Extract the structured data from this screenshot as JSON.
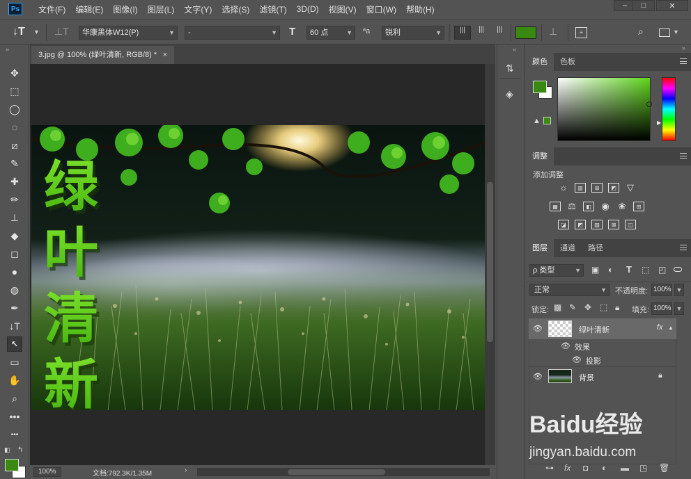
{
  "app": {
    "logo": "Ps",
    "menu": [
      "文件(F)",
      "编辑(E)",
      "图像(I)",
      "图层(L)",
      "文字(Y)",
      "选择(S)",
      "滤镜(T)",
      "3D(D)",
      "视图(V)",
      "窗口(W)",
      "帮助(H)"
    ],
    "window_controls": [
      "–",
      "□",
      "✕"
    ]
  },
  "options": {
    "tool_glyph": "↓T",
    "font_family": "华康黑体W12(P)",
    "font_style": "-",
    "font_size": "60 点",
    "aa_label": "ªa",
    "antialias": "锐利",
    "text_color": "#3a8a12"
  },
  "document": {
    "tab_title": "3.jpg @ 100% (绿叶清新, RGB/8) *",
    "tab_close": "×",
    "overlay_text": [
      "绿",
      "叶",
      "清",
      "新"
    ],
    "zoom": "100%",
    "doc_info": "文档:792.3K/1.35M"
  },
  "tools": [
    "✥",
    "⬚",
    "◯",
    "◌",
    "⧄",
    "✎",
    "✚",
    "✏",
    "⊥",
    "◆",
    "◻",
    "●",
    "◍",
    "✒",
    "↓T",
    "↖",
    "▭",
    "✋",
    "⌕",
    "•••"
  ],
  "colors": {
    "foreground": "#3a8a12",
    "background": "#ffffff",
    "accent_green": "#5fd51c"
  },
  "color_panel": {
    "tabs": [
      "颜色",
      "色板"
    ]
  },
  "adjust_panel": {
    "tab": "调整",
    "label": "添加调整"
  },
  "layers_panel": {
    "tabs": [
      "图层",
      "通道",
      "路径"
    ],
    "filter_kind": "ρ 类型",
    "blend_mode": "正常",
    "opacity_label": "不透明度:",
    "opacity": "100%",
    "lock_label": "锁定:",
    "fill_label": "填充:",
    "fill": "100%",
    "layers": [
      {
        "name": "绿叶清新",
        "fx": "fx",
        "effects_label": "效果",
        "effect": "投影"
      },
      {
        "name": "背景",
        "locked": true
      }
    ]
  },
  "bottom_icons": [
    "⊶",
    "fx",
    "◘",
    "◐",
    "▬",
    "◳",
    "🗑"
  ],
  "watermark": {
    "brand": "Baidu经验",
    "url": "jingyan.baidu.com"
  }
}
